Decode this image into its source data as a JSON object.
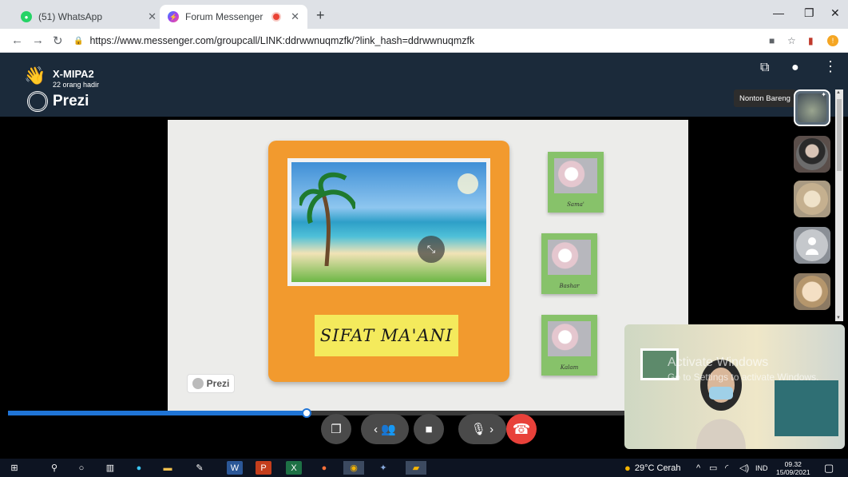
{
  "browser": {
    "tabs": [
      {
        "title": "(51) WhatsApp",
        "favicon": "whatsapp-icon",
        "active": false
      },
      {
        "title": "Forum Messenger",
        "favicon": "messenger-icon",
        "active": true
      }
    ],
    "new_tab_symbol": "+",
    "url": "https://www.messenger.com/groupcall/LINK:ddrwwnuqmzfk/?link_hash=ddrwwnuqmzfk"
  },
  "call": {
    "group_name": "X-MIPA2",
    "attendance": "22 orang hadir",
    "presentation_brand": "Prezi",
    "tooltip": "Nonton Bareng",
    "progress_fraction": 0.44
  },
  "slide": {
    "title": "SIFAT MA'ANI",
    "cards": [
      {
        "caption": "Sama'"
      },
      {
        "caption": "Bashar"
      },
      {
        "caption": "Kalam"
      }
    ],
    "badge_label": "Prezi"
  },
  "watermark": {
    "line1": "Activate Windows",
    "line2": "Go to Settings to activate Windows."
  },
  "taskbar": {
    "weather": "29°C  Cerah",
    "language": "IND",
    "time": "09.32",
    "date": "15/09/2021"
  },
  "colors": {
    "accent": "#1f74d6",
    "end_call": "#e8413a",
    "header": "#1b2a3a",
    "board": "#f29a2e"
  }
}
